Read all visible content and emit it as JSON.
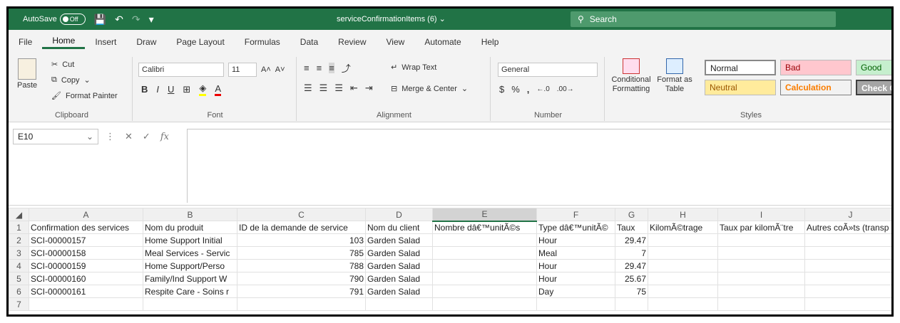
{
  "title_bar": {
    "autosave_label": "AutoSave",
    "autosave_state": "Off",
    "document_title": "serviceConfirmationItems (6)",
    "search_placeholder": "Search"
  },
  "menu": [
    "File",
    "Home",
    "Insert",
    "Draw",
    "Page Layout",
    "Formulas",
    "Data",
    "Review",
    "View",
    "Automate",
    "Help"
  ],
  "active_menu": "Home",
  "ribbon": {
    "clipboard": {
      "paste": "Paste",
      "cut": "Cut",
      "copy": "Copy",
      "format_painter": "Format Painter",
      "label": "Clipboard"
    },
    "font": {
      "name": "Calibri",
      "size": "11",
      "label": "Font"
    },
    "alignment": {
      "wrap_text": "Wrap Text",
      "merge_center": "Merge & Center",
      "label": "Alignment"
    },
    "number": {
      "format": "General",
      "label": "Number"
    },
    "styles": {
      "conditional_formatting": "Conditional Formatting",
      "format_as_table": "Format as Table",
      "cells": [
        "Normal",
        "Bad",
        "Good",
        "Neutral",
        "Calculation",
        "Check Cell"
      ],
      "label": "Styles"
    }
  },
  "formula_bar": {
    "name_box": "E10",
    "fx": "fx",
    "content": ""
  },
  "grid": {
    "columns": [
      "A",
      "B",
      "C",
      "D",
      "E",
      "F",
      "G",
      "H",
      "I",
      "J"
    ],
    "header_row": [
      "Confirmation des services",
      "Nom du produit",
      "ID de la demande de service",
      "Nom du client",
      "Nombre dâ€™unitÃ©s",
      "Type dâ€™unitÃ©",
      "Taux",
      "KilomÃ©trage",
      "Taux par kilomÃ¨tre",
      "Autres coÃ»ts (transp"
    ],
    "rows": [
      {
        "num": "2",
        "cells": [
          "SCI-00000157",
          "Home Support Initial",
          "103",
          "Garden Salad",
          "",
          "Hour",
          "29.47",
          "",
          "",
          ""
        ]
      },
      {
        "num": "3",
        "cells": [
          "SCI-00000158",
          "Meal Services - Servic",
          "785",
          "Garden Salad",
          "",
          "Meal",
          "7",
          "",
          "",
          ""
        ]
      },
      {
        "num": "4",
        "cells": [
          "SCI-00000159",
          "Home Support/Perso",
          "788",
          "Garden Salad",
          "",
          "Hour",
          "29.47",
          "",
          "",
          ""
        ]
      },
      {
        "num": "5",
        "cells": [
          "SCI-00000160",
          "Family/Ind Support W",
          "790",
          "Garden Salad",
          "",
          "Hour",
          "25.67",
          "",
          "",
          ""
        ]
      },
      {
        "num": "6",
        "cells": [
          "SCI-00000161",
          "Respite Care -  Soins r",
          "791",
          "Garden Salad",
          "",
          "Day",
          "75",
          "",
          "",
          ""
        ]
      },
      {
        "num": "7",
        "cells": [
          "",
          "",
          "",
          "",
          "",
          "",
          "",
          "",
          "",
          ""
        ]
      }
    ],
    "header_row_num": "1",
    "selected_column": "E"
  },
  "colors": {
    "excel_green": "#217346",
    "bad_bg": "#ffc7ce",
    "good_bg": "#c6efce",
    "neutral_bg": "#ffeb9c",
    "check_bg": "#a5a5a5"
  }
}
